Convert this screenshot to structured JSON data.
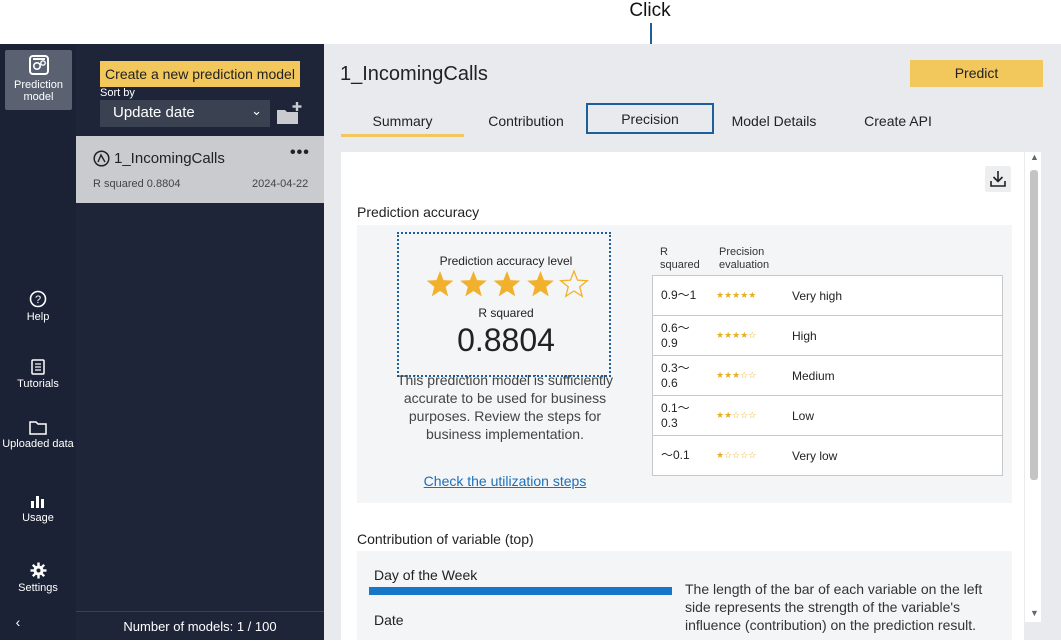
{
  "annotation": {
    "text": "Click"
  },
  "nav": {
    "items": [
      {
        "label": "Prediction model",
        "icon": "prediction-model-icon"
      },
      {
        "label": "Help",
        "icon": "help-icon"
      },
      {
        "label": "Tutorials",
        "icon": "tutorials-icon"
      },
      {
        "label": "Uploaded data",
        "icon": "folder-icon"
      },
      {
        "label": "Usage",
        "icon": "bar-chart-icon"
      },
      {
        "label": "Settings",
        "icon": "gear-icon"
      }
    ],
    "collapse": "‹"
  },
  "models": {
    "create_label": "Create a new prediction model",
    "sort_label": "Sort by",
    "sort_value": "Update date",
    "items": [
      {
        "name": "1_IncomingCalls",
        "metric": "R squared 0.8804",
        "date": "2024-04-22",
        "menu": "•••"
      }
    ],
    "count": "Number of models: 1 / 100"
  },
  "main": {
    "title": "1_IncomingCalls",
    "predict_label": "Predict",
    "tabs": [
      "Summary",
      "Contribution",
      "Precision",
      "Model Details",
      "Create API"
    ],
    "active_tab": "Summary"
  },
  "accuracy": {
    "section_title": "Prediction accuracy",
    "level_label": "Prediction accuracy level",
    "stars": 4,
    "stars_max": 5,
    "r2_label": "R squared",
    "r2_value": "0.8804",
    "description": "This prediction model is sufficiently accurate to be used for business purposes. Review the steps for business implementation.",
    "link": "Check the utilization steps",
    "table_head_r": "R squared",
    "table_head_p": "Precision evaluation",
    "rows": [
      {
        "range": "0.9～1",
        "stars": "★★★★★",
        "label": "Very high"
      },
      {
        "range": "0.6～0.9",
        "stars": "★★★★☆",
        "label": "High"
      },
      {
        "range": "0.3～0.6",
        "stars": "★★★☆☆",
        "label": "Medium"
      },
      {
        "range": "0.1～0.3",
        "stars": "★★☆☆☆",
        "label": "Low"
      },
      {
        "range": "～0.1",
        "stars": "★☆☆☆☆",
        "label": "Very low"
      }
    ]
  },
  "contribution": {
    "section_title": "Contribution of variable (top)",
    "var1": "Day of the Week",
    "var1_fraction": 1.0,
    "var2": "Date",
    "description": "The length of the bar of each variable on the left side represents the strength of the variable's influence (contribution) on the prediction result."
  },
  "colors": {
    "accent": "#f2c75c",
    "annotation": "#1d5f9a",
    "link": "#1d6fb8",
    "bar": "#1677c9",
    "star": "#f2b12c"
  }
}
